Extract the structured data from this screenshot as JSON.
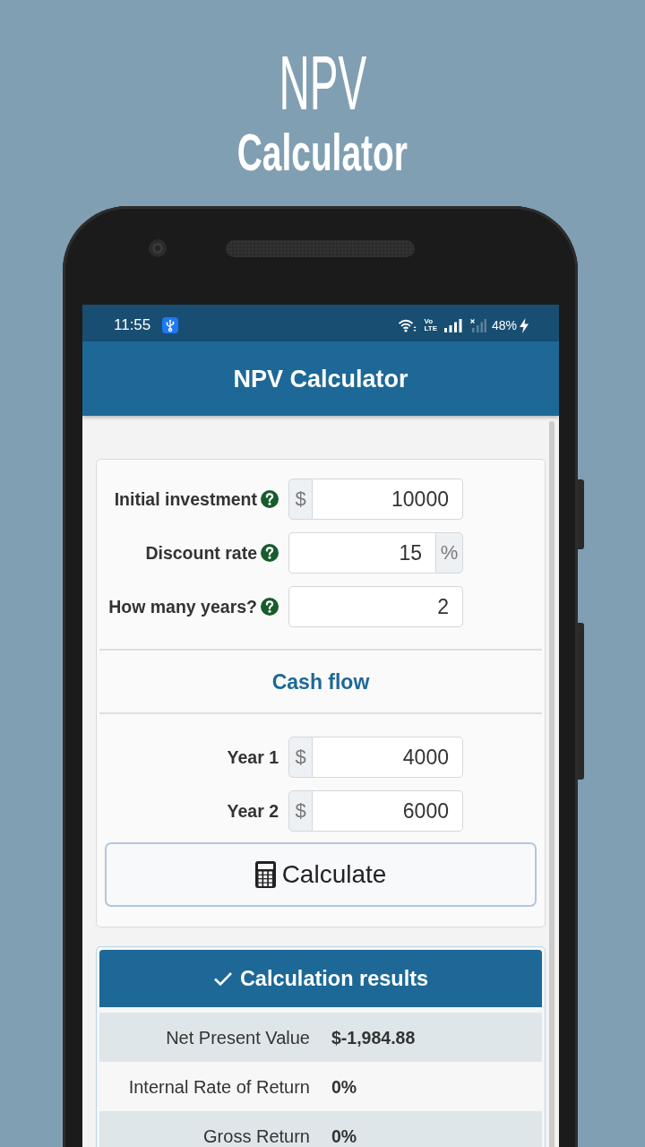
{
  "promo": {
    "title": "NPV",
    "subtitle": "Calculator"
  },
  "status_bar": {
    "time": "11:55",
    "volte": [
      "Vo",
      "LTE"
    ],
    "battery": "48%"
  },
  "app_bar": {
    "title": "NPV Calculator"
  },
  "inputs": [
    {
      "label": "Initial investment",
      "help": true,
      "prefix": "$",
      "value": "10000"
    },
    {
      "label": "Discount rate",
      "help": true,
      "suffix": "%",
      "value": "15"
    },
    {
      "label": "How many years?",
      "help": true,
      "value": "2"
    }
  ],
  "cash_flow": {
    "title": "Cash flow",
    "years": [
      {
        "label": "Year 1",
        "prefix": "$",
        "value": "4000"
      },
      {
        "label": "Year 2",
        "prefix": "$",
        "value": "6000"
      }
    ]
  },
  "calculate_button": {
    "label": "Calculate"
  },
  "results": {
    "title": "Calculation results",
    "rows": [
      {
        "label": "Net Present Value",
        "value": "$-1,984.88"
      },
      {
        "label": "Internal Rate of Return",
        "value": "0%"
      },
      {
        "label": "Gross Return",
        "value": "0%"
      }
    ]
  }
}
